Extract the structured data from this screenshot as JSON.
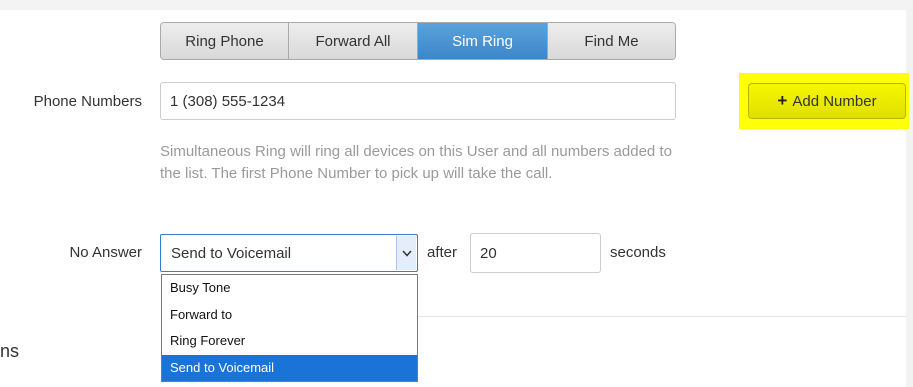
{
  "mode_tabs": [
    {
      "label": "Ring Phone"
    },
    {
      "label": "Forward All"
    },
    {
      "label": "Sim Ring",
      "active": true
    },
    {
      "label": "Find Me"
    }
  ],
  "phone_numbers": {
    "label": "Phone Numbers",
    "value": "1 (308) 555-1234",
    "help_text": "Simultaneous Ring will ring all devices on this User and all numbers added to the list. The first Phone Number to pick up will take the call."
  },
  "add_number": {
    "icon": "plus-icon",
    "label": "Add Number",
    "highlight_color": "#ffff0a"
  },
  "no_answer": {
    "label": "No Answer",
    "selected": "Send to Voicemail",
    "options": [
      "Busy Tone",
      "Forward to",
      "Ring Forever",
      "Send to Voicemail"
    ],
    "after_label": "after",
    "seconds_value": "20",
    "seconds_label": "seconds"
  },
  "section_partial_text": "ns",
  "colors": {
    "active_tab": "#3c86c8",
    "selected_option": "#1a73d6",
    "help_text": "#9a9a9a"
  }
}
